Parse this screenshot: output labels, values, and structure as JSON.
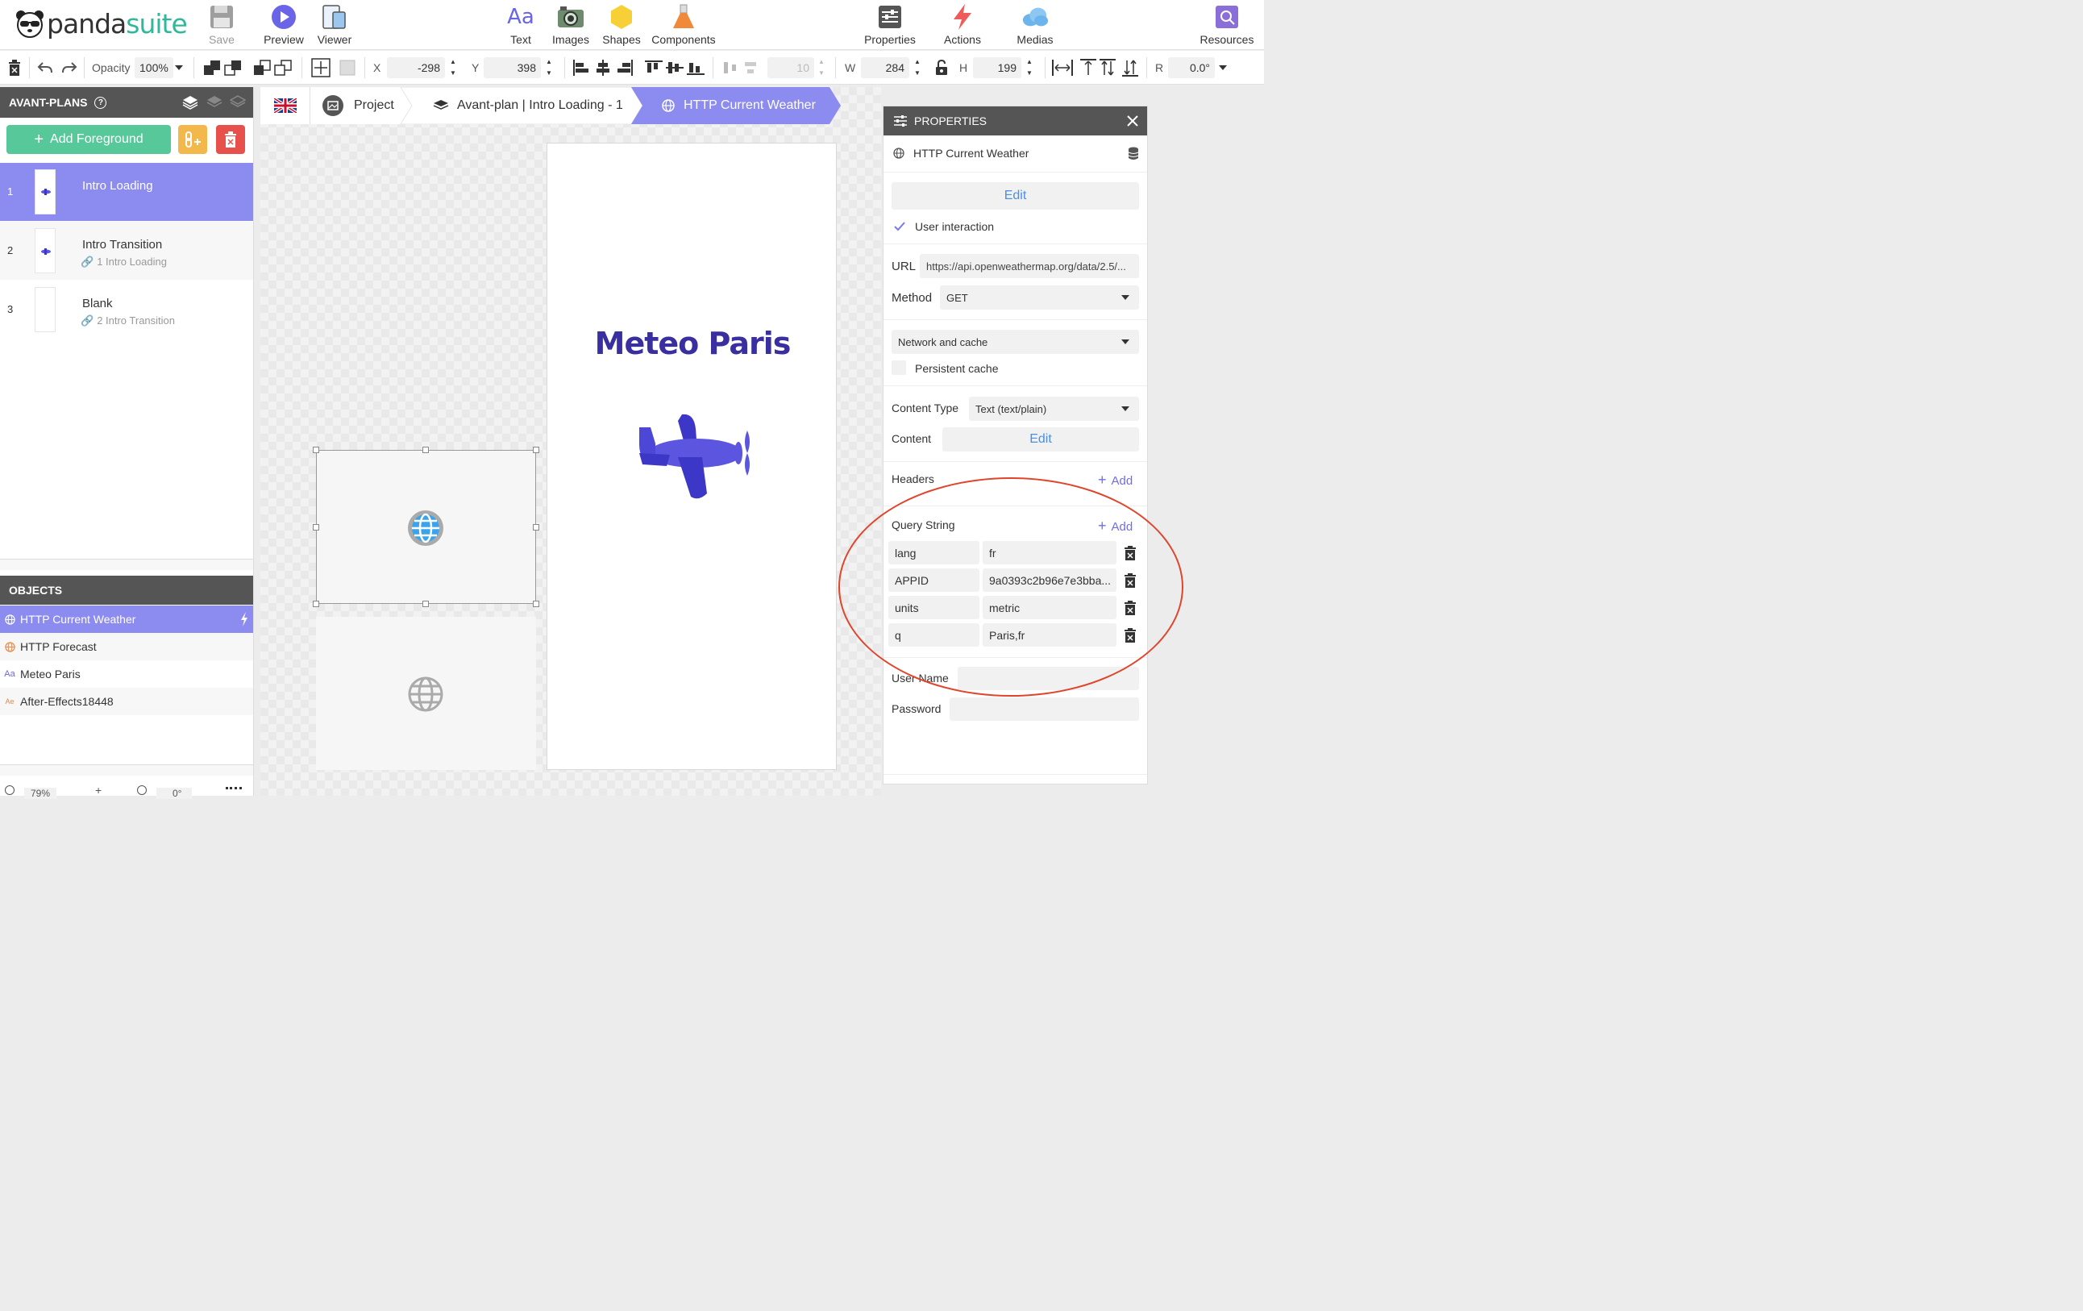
{
  "app": {
    "brand_part1": "panda",
    "brand_part2": "suite",
    "accent": "#8c8cf0",
    "brand_color": "#2fb89a"
  },
  "top_tools": {
    "save": "Save",
    "preview": "Preview",
    "viewer": "Viewer",
    "text": "Text",
    "images": "Images",
    "shapes": "Shapes",
    "components": "Components",
    "properties": "Properties",
    "actions": "Actions",
    "medias": "Medias",
    "resources": "Resources"
  },
  "toolbar2": {
    "opacity_label": "Opacity",
    "opacity_value": "100%",
    "x_label": "X",
    "x_value": "-298",
    "y_label": "Y",
    "y_value": "398",
    "spacing_value": "10",
    "w_label": "W",
    "w_value": "284",
    "h_label": "H",
    "h_value": "199",
    "r_label": "R",
    "r_value": "0.0°"
  },
  "foregrounds": {
    "header": "AVANT-PLANS",
    "add_label": "Add Foreground",
    "items": [
      {
        "num": "1",
        "title": "Intro Loading",
        "sub": ""
      },
      {
        "num": "2",
        "title": "Intro Transition",
        "sub": "1  Intro Loading"
      },
      {
        "num": "3",
        "title": "Blank",
        "sub": "2  Intro Transition"
      }
    ]
  },
  "objects": {
    "header": "OBJECTS",
    "items": [
      {
        "label": "HTTP Current Weather",
        "icon": "globe-icon"
      },
      {
        "label": "HTTP Forecast",
        "icon": "globe-icon"
      },
      {
        "label": "Meteo Paris",
        "icon": "text-icon",
        "glyph": "Aa"
      },
      {
        "label": "After-Effects18448",
        "icon": "after-effects-icon",
        "glyph": "Ae"
      }
    ]
  },
  "bottom": {
    "zoom": "79%",
    "rotation": "0°"
  },
  "breadcrumb": {
    "project": "Project",
    "foreground": "Avant-plan | Intro Loading - 1",
    "current": "HTTP Current Weather"
  },
  "canvas": {
    "title": "Meteo Paris"
  },
  "properties": {
    "header": "PROPERTIES",
    "object_name": "HTTP Current Weather",
    "edit_label": "Edit",
    "user_interaction": "User interaction",
    "url_label": "URL",
    "url_value": "https://api.openweathermap.org/data/2.5/...",
    "method_label": "Method",
    "method_value": "GET",
    "cache_value": "Network and cache",
    "persistent_cache": "Persistent cache",
    "content_type_label": "Content Type",
    "content_type_value": "Text (text/plain)",
    "content_label": "Content",
    "content_edit": "Edit",
    "headers_label": "Headers",
    "add_label": "Add",
    "query_label": "Query String",
    "query": [
      {
        "key": "lang",
        "value": "fr"
      },
      {
        "key": "APPID",
        "value": "9a0393c2b96e7e3bba..."
      },
      {
        "key": "units",
        "value": "metric"
      },
      {
        "key": "q",
        "value": "Paris,fr"
      }
    ],
    "username_label": "User Name",
    "password_label": "Password"
  }
}
